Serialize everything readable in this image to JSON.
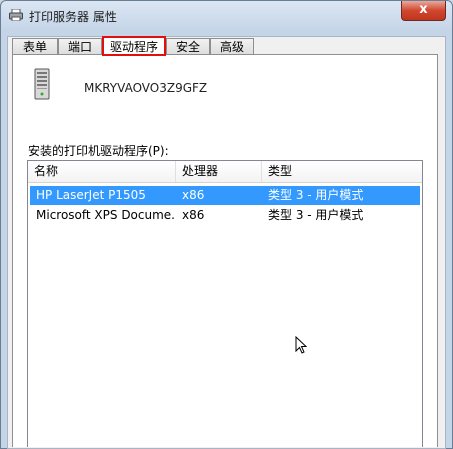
{
  "window": {
    "title": "打印服务器 属性",
    "close_label": "x"
  },
  "tabs": [
    {
      "label": "表单"
    },
    {
      "label": "端口"
    },
    {
      "label": "驱动程序",
      "active": true
    },
    {
      "label": "安全"
    },
    {
      "label": "高级"
    }
  ],
  "server": {
    "name": "MKRYVAOVO3Z9GFZ",
    "icon": "server-computer-icon"
  },
  "drivers": {
    "section_label": "安装的打印机驱动程序(P):",
    "columns": [
      "名称",
      "处理器",
      "类型"
    ],
    "rows": [
      {
        "name": "HP LaserJet P1505",
        "processor": "x86",
        "type": "类型 3 - 用户模式",
        "selected": true
      },
      {
        "name": "Microsoft XPS Docume...",
        "processor": "x86",
        "type": "类型 3 - 用户模式",
        "selected": false
      }
    ]
  },
  "colors": {
    "selection": "#3399ff",
    "tab_highlight": "#e01010",
    "close_button": "#c0341c"
  }
}
